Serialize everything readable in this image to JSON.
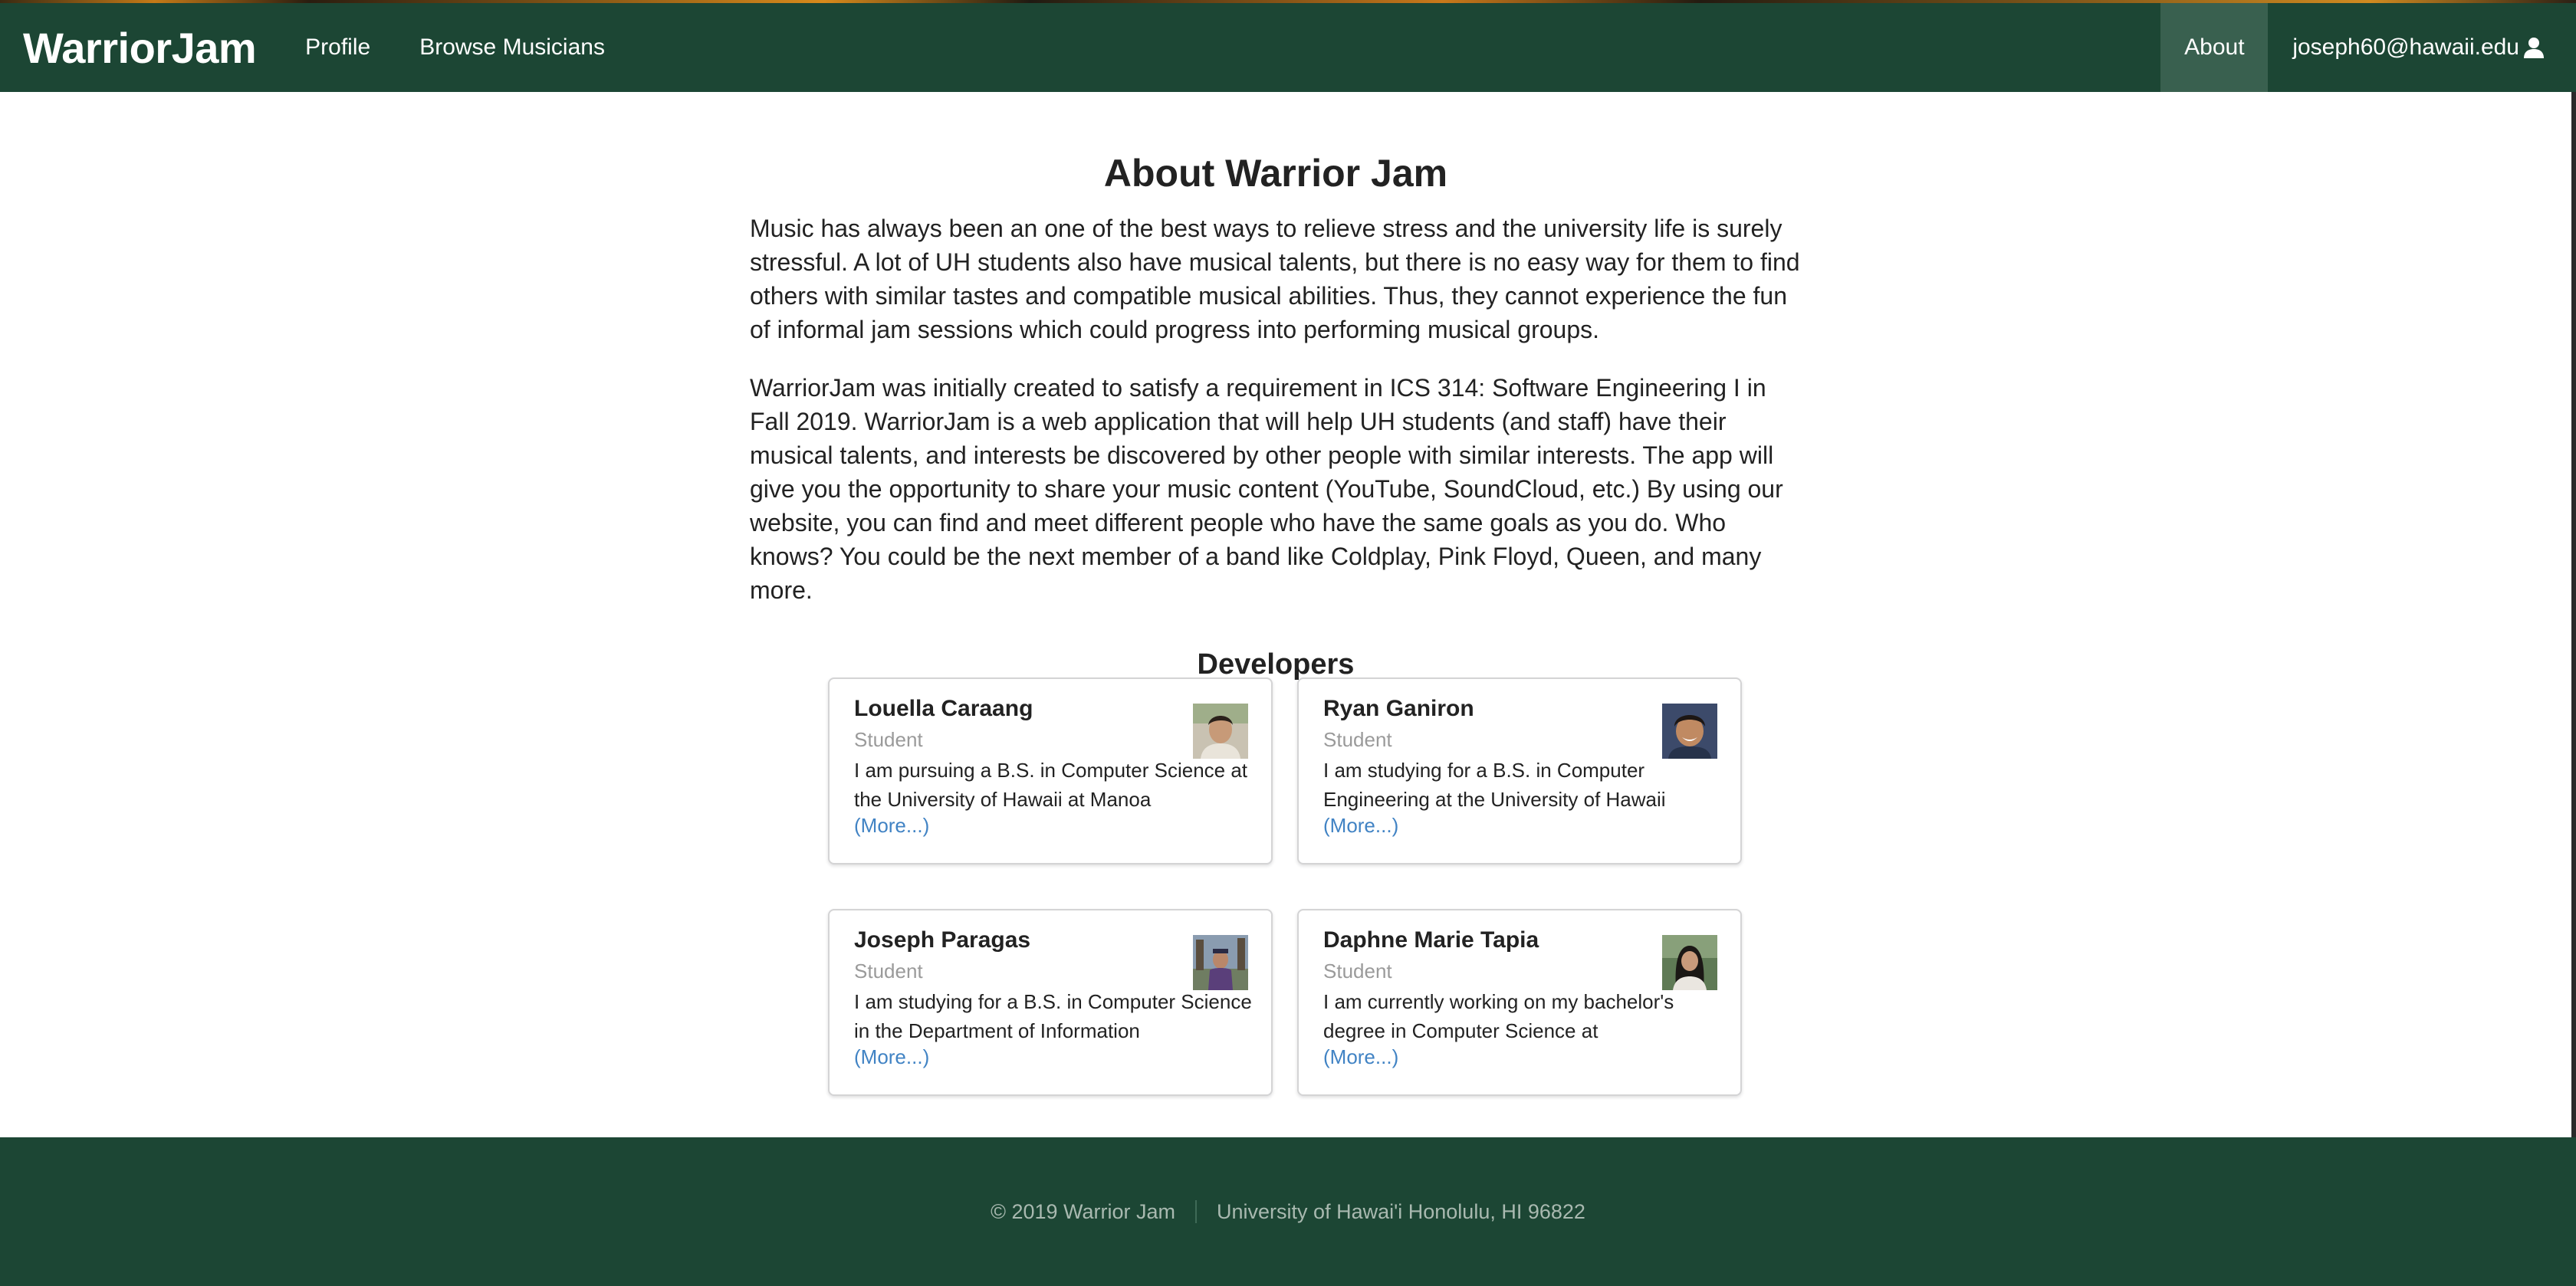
{
  "navbar": {
    "brand": "WarriorJam",
    "links": [
      "Profile",
      "Browse Musicians"
    ],
    "about_label": "About",
    "user_email": "joseph60@hawaii.edu"
  },
  "main": {
    "title": "About Warrior Jam",
    "paragraphs": [
      "Music has always been an one of the best ways to relieve stress and the university life is surely stressful. A lot of UH students also have musical talents, but there is no easy way for them to find others with similar tastes and compatible musical abilities. Thus, they cannot experience the fun of informal jam sessions which could progress into performing musical groups.",
      "WarriorJam was initially created to satisfy a requirement in ICS 314: Software Engineering I in Fall 2019. WarriorJam is a web application that will help UH students (and staff) have their musical talents, and interests be discovered by other people with similar interests. The app will give you the opportunity to share your music content (YouTube, SoundCloud, etc.) By using our website, you can find and meet different people who have the same goals as you do. Who knows? You could be the next member of a band like Coldplay, Pink Floyd, Queen, and many more."
    ],
    "developers_title": "Developers",
    "developers": [
      {
        "name": "Louella Caraang",
        "role": "Student",
        "description": "I am pursuing a B.S. in Computer Science at the University of Hawaii at Manoa",
        "more": "(More...)",
        "avatar_icon": "person-photo-icon"
      },
      {
        "name": "Ryan Ganiron",
        "role": "Student",
        "description": "I am studying for a B.S. in Computer Engineering at the University of Hawaii",
        "more": "(More...)",
        "avatar_icon": "person-photo-icon"
      },
      {
        "name": "Joseph Paragas",
        "role": "Student",
        "description": "I am studying for a B.S. in Computer Science in the Department of Information",
        "more": "(More...)",
        "avatar_icon": "person-photo-icon"
      },
      {
        "name": "Daphne Marie Tapia",
        "role": "Student",
        "description": "I am currently working on my bachelor's degree in Computer Science at",
        "more": "(More...)",
        "avatar_icon": "person-photo-icon"
      }
    ]
  },
  "footer": {
    "copyright": "© 2019 Warrior Jam",
    "address": "University of Hawai'i Honolulu, HI 96822"
  },
  "colors": {
    "navbar_bg": "#1c4634",
    "nav_active_bg": "#39604f",
    "link": "#4183c4",
    "muted_text": "#9a9a9a"
  }
}
